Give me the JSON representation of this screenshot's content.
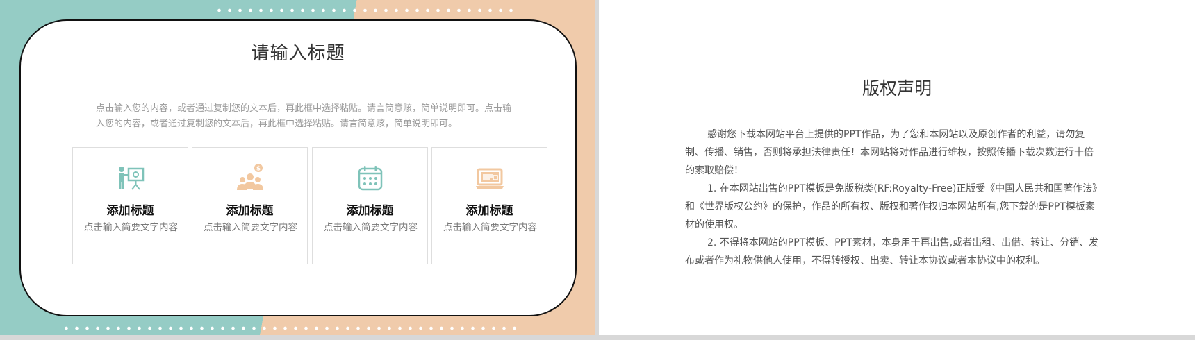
{
  "left_slide": {
    "title": "请输入标题",
    "description": "点击输入您的内容，或者通过复制您的文本后，再此框中选择粘贴。请言简意赅，简单说明即可。点击输入您的内容，或者通过复制您的文本后，再此框中选择粘贴。请言简意赅，简单说明即可。",
    "boxes": [
      {
        "icon": "presenter-icon",
        "title": "添加标题",
        "text": "点击输入简要文字内容"
      },
      {
        "icon": "team-money-icon",
        "title": "添加标题",
        "text": "点击输入简要文字内容"
      },
      {
        "icon": "calendar-icon",
        "title": "添加标题",
        "text": "点击输入简要文字内容"
      },
      {
        "icon": "laptop-icon",
        "title": "添加标题",
        "text": "点击输入简要文字内容"
      }
    ]
  },
  "right_slide": {
    "title": "版权声明",
    "paragraphs": [
      "感谢您下载本网站平台上提供的PPT作品，为了您和本网站以及原创作者的利益，请勿复制、传播、销售，否则将承担法律责任！本网站将对作品进行维权，按照传播下载次数进行十倍的索取赔偿！",
      "1. 在本网站出售的PPT模板是免版税类(RF:Royalty-Free)正版受《中国人民共和国著作法》和《世界版权公约》的保护，作品的所有权、版权和著作权归本网站所有,您下载的是PPT模板素材的使用权。",
      "2. 不得将本网站的PPT模板、PPT素材，本身用于再出售,或者出租、出借、转让、分销、发布或者作为礼物供他人使用，不得转授权、出卖、转让本协议或者本协议中的权利。"
    ]
  },
  "colors": {
    "teal": "#95ccc5",
    "peach": "#f0cbab",
    "icon_teal": "#7fc3b9",
    "icon_peach": "#f2c8a0"
  }
}
